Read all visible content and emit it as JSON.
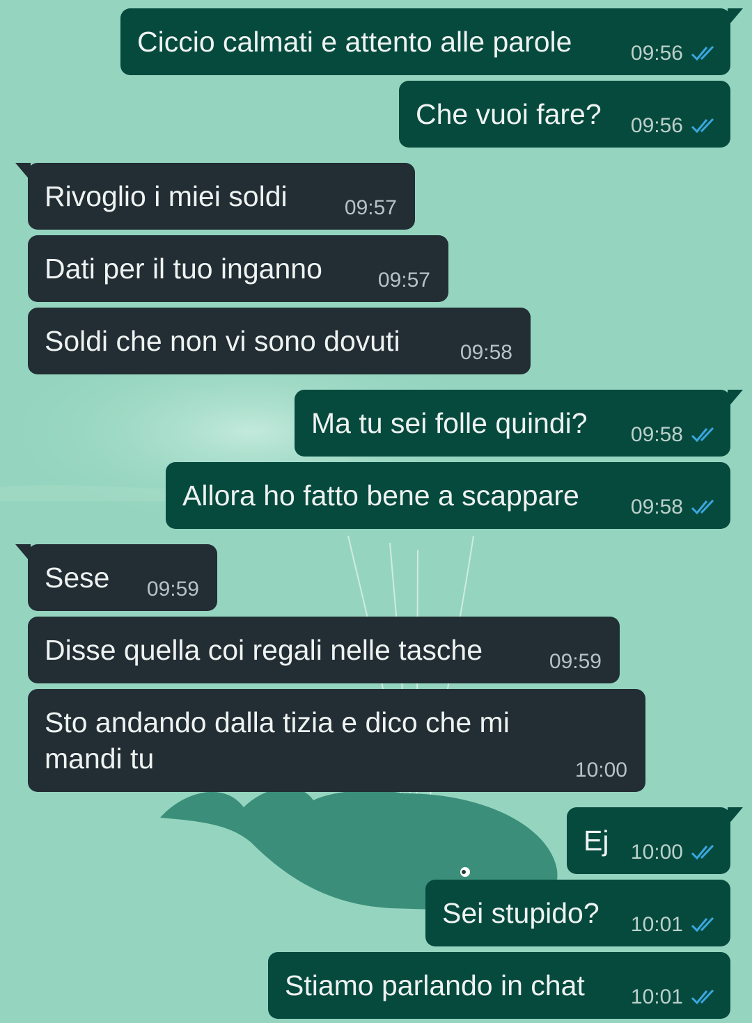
{
  "chat": {
    "messages": [
      {
        "dir": "out",
        "text": "Ciccio calmati e attento alle parole",
        "time": "09:56",
        "ticks": "read-double-check-icon"
      },
      {
        "dir": "out",
        "text": "Che vuoi fare?",
        "time": "09:56",
        "ticks": "read-double-check-icon"
      },
      {
        "dir": "in",
        "text": "Rivoglio i miei soldi",
        "time": "09:57"
      },
      {
        "dir": "in",
        "text": "Dati per il tuo inganno",
        "time": "09:57"
      },
      {
        "dir": "in",
        "text": "Soldi che non vi sono dovuti",
        "time": "09:58"
      },
      {
        "dir": "out",
        "text": "Ma tu sei folle quindi?",
        "time": "09:58",
        "ticks": "read-double-check-icon"
      },
      {
        "dir": "out",
        "text": "Allora ho fatto bene a scappare",
        "time": "09:58",
        "ticks": "read-double-check-icon"
      },
      {
        "dir": "in",
        "text": "Sese",
        "time": "09:59"
      },
      {
        "dir": "in",
        "text": "Disse quella coi regali nelle tasche",
        "time": "09:59"
      },
      {
        "dir": "in",
        "text": "Sto andando dalla tizia e dico che mi mandi tu",
        "time": "10:00"
      },
      {
        "dir": "out",
        "text": "Ej",
        "time": "10:00",
        "ticks": "read-double-check-icon"
      },
      {
        "dir": "out",
        "text": "Sei stupido?",
        "time": "10:01",
        "ticks": "read-double-check-icon"
      },
      {
        "dir": "out",
        "text": "Stiamo parlando in chat",
        "time": "10:01",
        "ticks": "read-double-check-icon"
      }
    ]
  },
  "colors": {
    "wallpaper": "#95d5bf",
    "outgoing_bubble": "#064a3e",
    "incoming_bubble": "#222d34",
    "read_ticks": "#3aa7e0",
    "whale": "#3b8f7a"
  }
}
